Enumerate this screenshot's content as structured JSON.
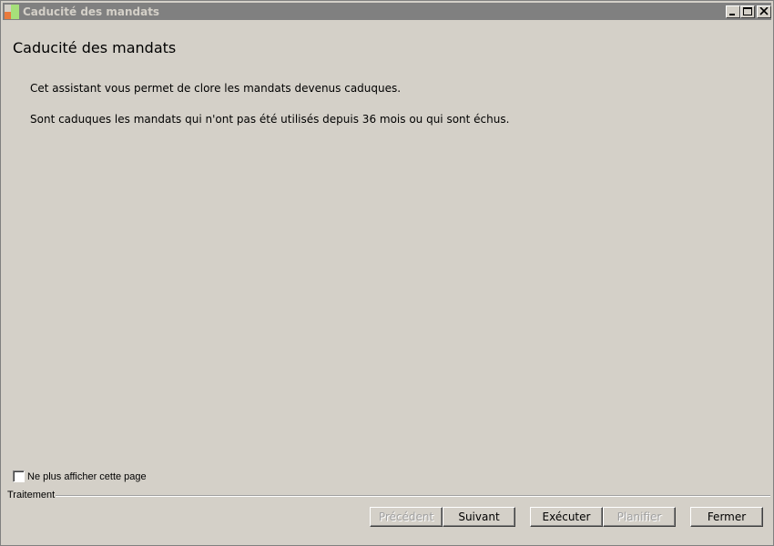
{
  "window": {
    "title": "Caducité des mandats",
    "controls": {
      "minimize": "minimize",
      "maximize": "maximize",
      "close": "close"
    }
  },
  "main": {
    "heading": "Caducité des mandats",
    "paragraphs": [
      "Cet assistant vous permet de clore les mandats devenus caduques.",
      "Sont caduques les mandats qui n'ont pas été utilisés depuis 36 mois ou qui sont échus."
    ]
  },
  "options": {
    "dont_show_label": "Ne plus afficher cette page",
    "dont_show_checked": false
  },
  "footer": {
    "group_label": "Traitement",
    "buttons": {
      "previous": "Précédent",
      "next": "Suivant",
      "execute": "Exécuter",
      "schedule": "Planifier",
      "close": "Fermer"
    },
    "disabled": [
      "previous",
      "schedule"
    ]
  },
  "colors": {
    "background": "#d4d0c8",
    "titlebar": "#808080",
    "disabled_text": "#a0a0a0"
  }
}
